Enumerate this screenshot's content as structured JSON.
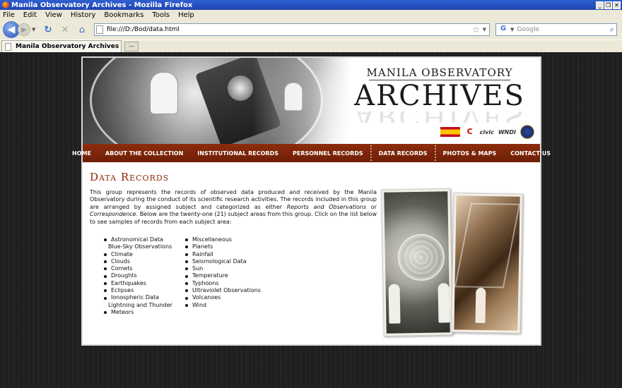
{
  "browser": {
    "window_title": "Manila Observatory Archives - Mozilla Firefox",
    "menu": [
      "File",
      "Edit",
      "View",
      "History",
      "Bookmarks",
      "Tools",
      "Help"
    ],
    "url": "file:///D:/Bod/data.html",
    "search_placeholder": "Google",
    "tab_title": "Manila Observatory Archives"
  },
  "site": {
    "brand_top": "MANILA OBSERVATORY",
    "brand_main": "ARCHIVES",
    "logo_words": [
      "civic",
      "WNDI"
    ],
    "nav": [
      "HOME",
      "ABOUT THE COLLECTION",
      "INSTITUTIONAL RECORDS",
      "PERSONNEL RECORDS",
      "DATA RECORDS",
      "PHOTOS & MAPS",
      "CONTACT US"
    ],
    "active_nav": "DATA RECORDS",
    "heading": "Data Records",
    "intro_1": "This group represents the records of observed data produced and received by the Manila Observatory during the conduct of its scientific research activities. The records included in this group are arranged by assigned subject and categorized as either ",
    "intro_em1": "Reports and Observations",
    "intro_2": " or ",
    "intro_em2": "Correspondence",
    "intro_3": ". Below are the twenty-one (21) subject areas from this group. Click on the list below to see samples of records from each subject area:",
    "subjects_col1": [
      "Astronomical Data",
      "Blue-Sky Observations",
      "Climate",
      "Clouds",
      "Comets",
      "Droughts",
      "Earthquakes",
      "Eclipses",
      "Ionospheric Data",
      "Lightning and Thunder",
      "Meteors"
    ],
    "subjects_col2": [
      "Miscellaneous",
      "Planets",
      "Rainfall",
      "Seismological Data",
      "Sun",
      "Temperature",
      "Typhoons",
      "Ultraviolet Observations",
      "Volcanoes",
      "Wind"
    ]
  },
  "colors": {
    "nav_bg": "#8c2c0c",
    "heading": "#8e2a08",
    "titlebar": "#2f5fd0"
  }
}
